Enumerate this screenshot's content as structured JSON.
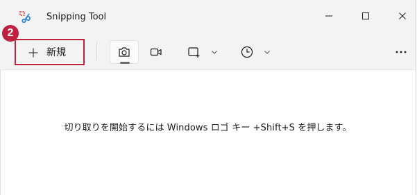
{
  "window": {
    "title": "Snipping Tool"
  },
  "annotation": {
    "step_number": "2",
    "color": "#c0213f"
  },
  "toolbar": {
    "new_label": "新規",
    "modes": [
      {
        "name": "screenshot",
        "icon": "camera-icon",
        "selected": true
      },
      {
        "name": "record",
        "icon": "video-camera-icon",
        "selected": false
      }
    ],
    "shape_icon": "rectangle-snip-icon",
    "delay_icon": "clock-icon",
    "more_icon": "ellipsis-icon"
  },
  "content": {
    "hint": "切り取りを開始するには Windows ロゴ キー +Shift+S を押します。"
  },
  "colors": {
    "background": "#f3f3f3",
    "content_background": "#ffffff",
    "text": "#1a1a1a"
  }
}
